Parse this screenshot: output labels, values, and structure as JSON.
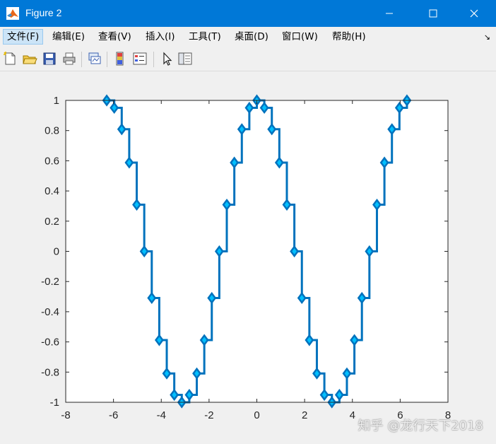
{
  "window": {
    "title": "Figure 2"
  },
  "menu": {
    "items": [
      "文件(F)",
      "编辑(E)",
      "查看(V)",
      "插入(I)",
      "工具(T)",
      "桌面(D)",
      "窗口(W)",
      "帮助(H)"
    ],
    "overflow_glyph": "↘"
  },
  "toolbar": {
    "icons": [
      "new-figure-icon",
      "open-file-icon",
      "save-icon",
      "print-icon",
      "link-plot-icon",
      "insert-colorbar-icon",
      "insert-legend-icon",
      "edit-plot-icon",
      "property-inspector-icon"
    ]
  },
  "watermark": "知乎 @龙行天下2018",
  "colors": {
    "line": "#0072bd",
    "marker_face": "#00bfff",
    "titlebar": "#0078d7"
  },
  "chart_data": {
    "type": "line",
    "style": "stairs",
    "marker": "diamond",
    "xlim": [
      -8,
      8
    ],
    "ylim": [
      -1,
      1
    ],
    "xticks": [
      -8,
      -6,
      -4,
      -2,
      0,
      2,
      4,
      6,
      8
    ],
    "yticks": [
      -1,
      -0.8,
      -0.6,
      -0.4,
      -0.2,
      0,
      0.2,
      0.4,
      0.6,
      0.8,
      1
    ],
    "xtick_labels": [
      "-8",
      "-6",
      "-4",
      "-2",
      "0",
      "2",
      "4",
      "6",
      "8"
    ],
    "ytick_labels": [
      "-1",
      "-0.8",
      "-0.6",
      "-0.4",
      "-0.2",
      "0",
      "0.2",
      "0.4",
      "0.6",
      "0.8",
      "1"
    ],
    "grid": false,
    "series": [
      {
        "x": [
          -6.283,
          -5.969,
          -5.655,
          -5.341,
          -5.027,
          -4.712,
          -4.398,
          -4.084,
          -3.77,
          -3.456,
          -3.142,
          -2.827,
          -2.513,
          -2.199,
          -1.885,
          -1.571,
          -1.257,
          -0.942,
          -0.628,
          -0.314,
          0.0,
          0.314,
          0.628,
          0.942,
          1.257,
          1.571,
          1.885,
          2.199,
          2.513,
          2.827,
          3.142,
          3.456,
          3.77,
          4.084,
          4.398,
          4.712,
          5.027,
          5.341,
          5.655,
          5.969,
          6.283
        ],
        "y": [
          1.0,
          0.951,
          0.809,
          0.588,
          0.309,
          0.0,
          -0.309,
          -0.588,
          -0.809,
          -0.951,
          -1.0,
          -0.951,
          -0.809,
          -0.588,
          -0.309,
          0.0,
          0.309,
          0.588,
          0.809,
          0.951,
          1.0,
          0.951,
          0.809,
          0.588,
          0.309,
          0.0,
          -0.309,
          -0.588,
          -0.809,
          -0.951,
          -1.0,
          -0.951,
          -0.809,
          -0.588,
          -0.309,
          0.0,
          0.309,
          0.588,
          0.809,
          0.951,
          1.0
        ]
      }
    ]
  }
}
